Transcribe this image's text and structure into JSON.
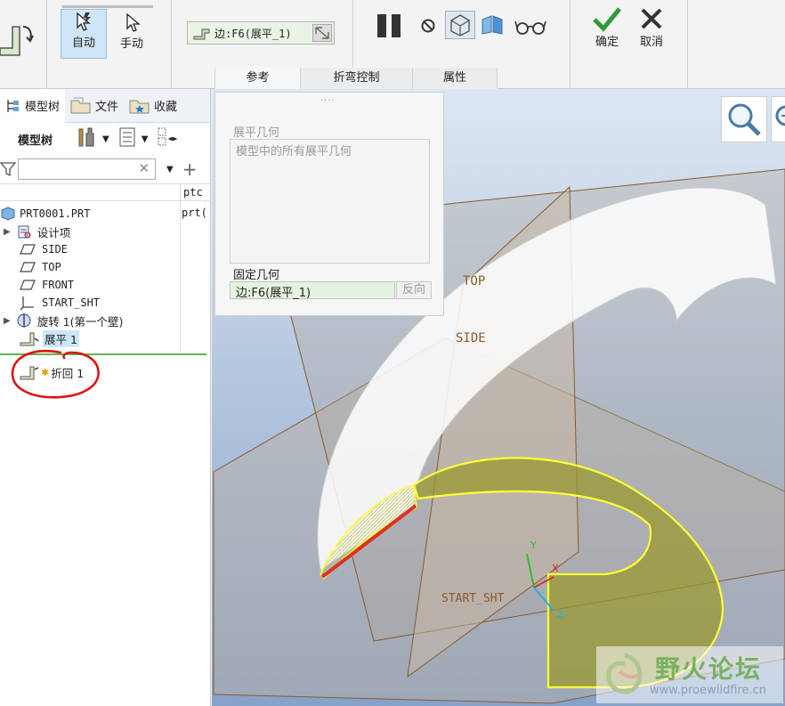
{
  "ribbon": {
    "auto_label": "自动",
    "manual_label": "手动",
    "reference_value": "边:F6(展平_1)",
    "confirm_label": "确定",
    "cancel_label": "取消",
    "tabs": [
      {
        "label": "参考"
      },
      {
        "label": "折弯控制"
      },
      {
        "label": "属性"
      }
    ]
  },
  "nav": {
    "tabs": [
      {
        "label": "模型树"
      },
      {
        "label": "文件"
      },
      {
        "label": "收藏"
      }
    ],
    "toolbar_title": "模型树",
    "filter_placeholder": "",
    "column_header": "ptc",
    "column_value": "prt(",
    "tree": [
      {
        "label": "PRT0001.PRT",
        "icon": "part-icon"
      },
      {
        "label": "设计项",
        "icon": "design-item-icon"
      },
      {
        "label": "SIDE",
        "icon": "datum-plane-icon"
      },
      {
        "label": "TOP",
        "icon": "datum-plane-icon"
      },
      {
        "label": "FRONT",
        "icon": "datum-plane-icon"
      },
      {
        "label": "START_SHT",
        "icon": "coordinate-system-icon"
      },
      {
        "label": "旋转 1(第一个壁)",
        "icon": "revolve-icon"
      },
      {
        "label": "展平 1",
        "icon": "unbend-icon"
      },
      {
        "label": "折回 1",
        "icon": "bend-back-icon"
      }
    ]
  },
  "ref_panel": {
    "unbend_geometry_label": "展平几何",
    "unbend_geometry_value": "模型中的所有展平几何",
    "fixed_geometry_label": "固定几何",
    "fixed_geometry_value": "边:F6(展平_1)",
    "flip_label": "反向"
  },
  "viewport": {
    "label_top": "TOP",
    "label_side": "SIDE",
    "label_start": "START_SHT",
    "axis_x": "X",
    "axis_y": "Y",
    "axis_z": "Z",
    "watermark_title": "野火论坛",
    "watermark_url": "www.proewildfire.cn"
  },
  "colors": {
    "viewport_top": "#dce6f2",
    "viewport_bottom": "#8aa4c8",
    "highlight_yellow": "#ffff33",
    "datum_brown": "#8b5a2b",
    "edge_red": "#e03020",
    "annotation_red": "#e01010"
  }
}
